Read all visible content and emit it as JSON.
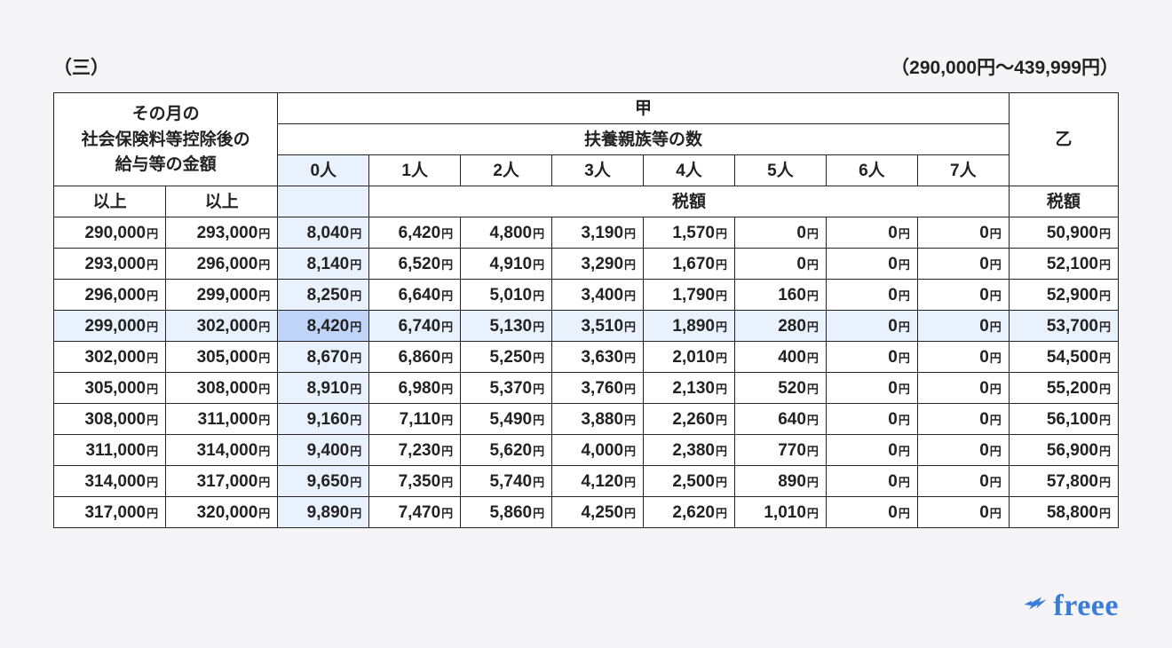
{
  "header": {
    "section_marker": "（三）",
    "range_note": "（290,000円〜439,999円）"
  },
  "table": {
    "salary_header": "その月の\n社会保険料等控除後の\n給与等の金額",
    "kou": "甲",
    "dependents_header": "扶養親族等の数",
    "otsu": "乙",
    "dep_labels": [
      "0人",
      "1人",
      "2人",
      "3人",
      "4人",
      "5人",
      "6人",
      "7人"
    ],
    "sub_ijou_left": "以上",
    "sub_ijou_right": "以上",
    "tax_label": "税額",
    "tax_label_otsu": "税額",
    "yen": "円"
  },
  "rows": [
    {
      "from": "290,000",
      "to": "293,000",
      "t": [
        "8,040",
        "6,420",
        "4,800",
        "3,190",
        "1,570",
        "0",
        "0",
        "0"
      ],
      "otsu": "50,900"
    },
    {
      "from": "293,000",
      "to": "296,000",
      "t": [
        "8,140",
        "6,520",
        "4,910",
        "3,290",
        "1,670",
        "0",
        "0",
        "0"
      ],
      "otsu": "52,100"
    },
    {
      "from": "296,000",
      "to": "299,000",
      "t": [
        "8,250",
        "6,640",
        "5,010",
        "3,400",
        "1,790",
        "160",
        "0",
        "0"
      ],
      "otsu": "52,900"
    },
    {
      "from": "299,000",
      "to": "302,000",
      "t": [
        "8,420",
        "6,740",
        "5,130",
        "3,510",
        "1,890",
        "280",
        "0",
        "0"
      ],
      "otsu": "53,700",
      "highlight": true
    },
    {
      "from": "302,000",
      "to": "305,000",
      "t": [
        "8,670",
        "6,860",
        "5,250",
        "3,630",
        "2,010",
        "400",
        "0",
        "0"
      ],
      "otsu": "54,500"
    },
    {
      "from": "305,000",
      "to": "308,000",
      "t": [
        "8,910",
        "6,980",
        "5,370",
        "3,760",
        "2,130",
        "520",
        "0",
        "0"
      ],
      "otsu": "55,200"
    },
    {
      "from": "308,000",
      "to": "311,000",
      "t": [
        "9,160",
        "7,110",
        "5,490",
        "3,880",
        "2,260",
        "640",
        "0",
        "0"
      ],
      "otsu": "56,100"
    },
    {
      "from": "311,000",
      "to": "314,000",
      "t": [
        "9,400",
        "7,230",
        "5,620",
        "4,000",
        "2,380",
        "770",
        "0",
        "0"
      ],
      "otsu": "56,900"
    },
    {
      "from": "314,000",
      "to": "317,000",
      "t": [
        "9,650",
        "7,350",
        "5,740",
        "4,120",
        "2,500",
        "890",
        "0",
        "0"
      ],
      "otsu": "57,800"
    },
    {
      "from": "317,000",
      "to": "320,000",
      "t": [
        "9,890",
        "7,470",
        "5,860",
        "4,250",
        "2,620",
        "1,010",
        "0",
        "0"
      ],
      "otsu": "58,800"
    }
  ],
  "logo": {
    "text": "freee"
  }
}
